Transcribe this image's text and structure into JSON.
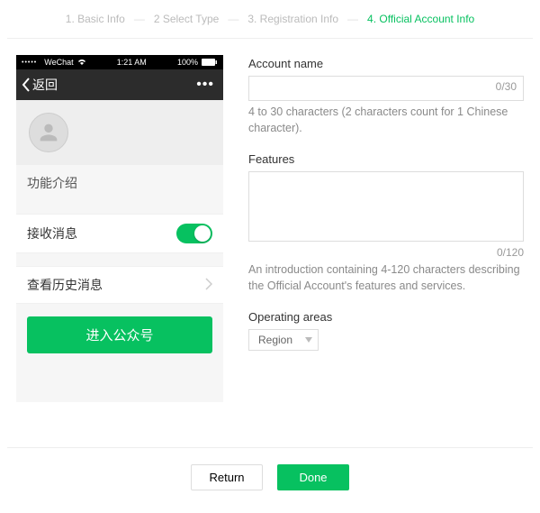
{
  "steps": {
    "items": [
      {
        "label": "1. Basic Info",
        "active": false
      },
      {
        "label": "2 Select Type",
        "active": false
      },
      {
        "label": "3. Registration Info",
        "active": false
      },
      {
        "label": "4. Official Account Info",
        "active": true
      }
    ]
  },
  "phone": {
    "status": {
      "carrier": "WeChat",
      "time": "1:21 AM",
      "battery": "100%"
    },
    "nav": {
      "back_label": "返回",
      "more": "•••"
    },
    "section_features": "功能介绍",
    "row_receive": "接收消息",
    "row_history": "查看历史消息",
    "enter_button": "进入公众号"
  },
  "form": {
    "account_name": {
      "label": "Account name",
      "value": "",
      "counter": "0/30",
      "hint": "4 to 30 characters (2 characters count for 1 Chinese character)."
    },
    "features": {
      "label": "Features",
      "value": "",
      "counter": "0/120",
      "hint": "An introduction containing 4-120 characters describing the Official Account's features and services."
    },
    "operating_areas": {
      "label": "Operating areas",
      "select_label": "Region"
    }
  },
  "footer": {
    "return": "Return",
    "done": "Done"
  }
}
